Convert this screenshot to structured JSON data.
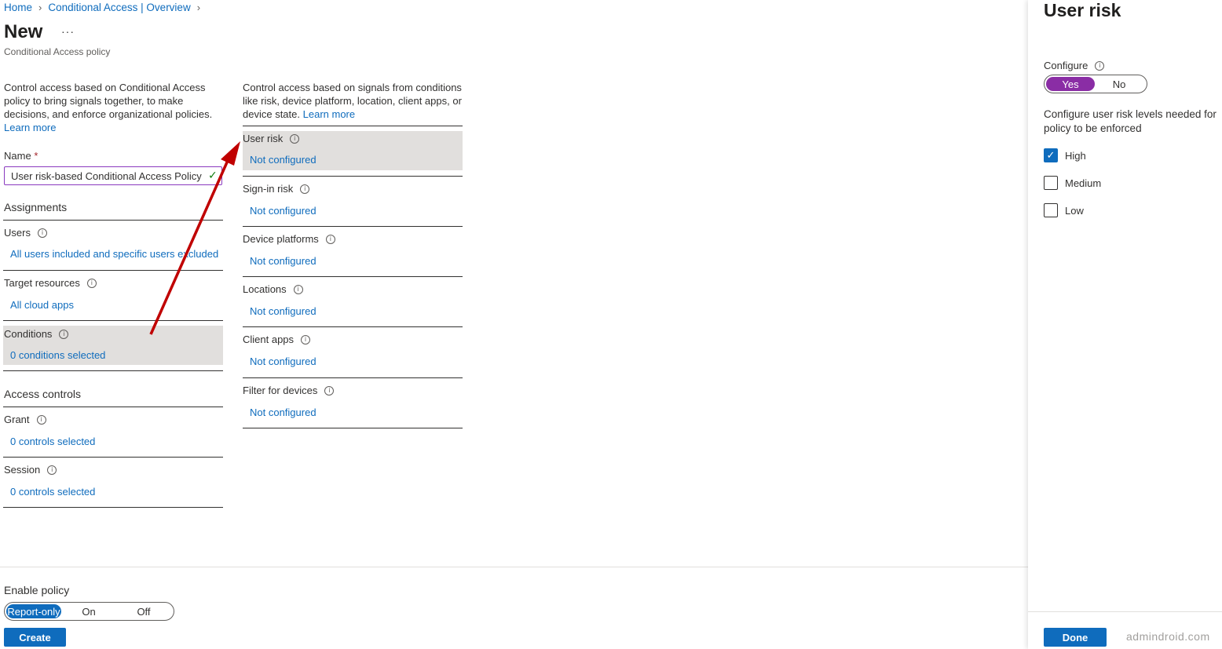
{
  "breadcrumb": {
    "home": "Home",
    "overview": "Conditional Access | Overview"
  },
  "page": {
    "title": "New",
    "more": "···",
    "subtitle": "Conditional Access policy"
  },
  "left": {
    "description": "Control access based on Conditional Access policy to bring signals together, to make decisions, and enforce organizational policies.",
    "learn_more": "Learn more",
    "name_label": "Name",
    "name_required": "*",
    "name_value": "User risk-based Conditional Access Policy",
    "assignments_heading": "Assignments",
    "access_controls_heading": "Access controls",
    "assignments": [
      {
        "title": "Users",
        "value": "All users included and specific users excluded"
      },
      {
        "title": "Target resources",
        "value": "All cloud apps"
      },
      {
        "title": "Conditions",
        "value": "0 conditions selected"
      }
    ],
    "access_controls": [
      {
        "title": "Grant",
        "value": "0 controls selected"
      },
      {
        "title": "Session",
        "value": "0 controls selected"
      }
    ]
  },
  "middle": {
    "description": "Control access based on signals from conditions like risk, device platform, location, client apps, or device state.",
    "learn_more": "Learn more",
    "conditions": [
      {
        "title": "User risk",
        "value": "Not configured"
      },
      {
        "title": "Sign-in risk",
        "value": "Not configured"
      },
      {
        "title": "Device platforms",
        "value": "Not configured"
      },
      {
        "title": "Locations",
        "value": "Not configured"
      },
      {
        "title": "Client apps",
        "value": "Not configured"
      },
      {
        "title": "Filter for devices",
        "value": "Not configured"
      }
    ]
  },
  "panel": {
    "title": "User risk",
    "configure_label": "Configure",
    "configure_options": [
      "Yes",
      "No"
    ],
    "configure_selected": "Yes",
    "description": "Configure user risk levels needed for policy to be enforced",
    "levels": [
      {
        "label": "High",
        "checked": true
      },
      {
        "label": "Medium",
        "checked": false
      },
      {
        "label": "Low",
        "checked": false
      }
    ],
    "done_label": "Done",
    "watermark": "admindroid.com"
  },
  "footer": {
    "enable_label": "Enable policy",
    "enable_options": [
      "Report-only",
      "On",
      "Off"
    ],
    "enable_selected": "Report-only",
    "create_label": "Create"
  },
  "colors": {
    "link": "#0f6cbd",
    "accent_purple": "#8a2da5",
    "highlight": "#e1dfdd",
    "arrow": "#c00000"
  }
}
